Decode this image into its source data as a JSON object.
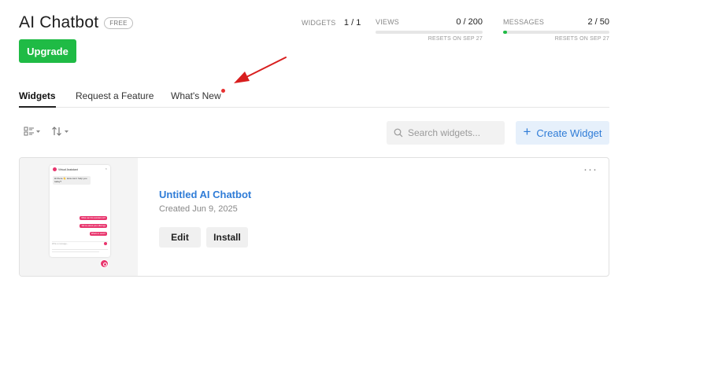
{
  "header": {
    "title": "AI Chatbot",
    "plan_badge": "FREE",
    "upgrade_label": "Upgrade"
  },
  "stats": {
    "widgets": {
      "label": "WIDGETS",
      "value": "1 / 1"
    },
    "views": {
      "label": "VIEWS",
      "value": "0 / 200",
      "reset": "RESETS ON SEP 27",
      "progress": 0.0
    },
    "messages": {
      "label": "MESSAGES",
      "value": "2 / 50",
      "reset": "RESETS ON SEP 27",
      "progress": 0.04
    }
  },
  "tabs": [
    {
      "label": "Widgets",
      "active": true
    },
    {
      "label": "Request a Feature",
      "active": false
    },
    {
      "label": "What's New",
      "active": false,
      "has_dot": true
    }
  ],
  "toolbar": {
    "search_placeholder": "Search widgets...",
    "create_label": "Create Widget"
  },
  "widgets": [
    {
      "name": "Untitled AI Chatbot",
      "created": "Created Jun 9, 2025",
      "edit_label": "Edit",
      "install_label": "Install",
      "preview": {
        "assistant_name": "Virtual Assistant",
        "greeting": "Hi there 👋 How can I help you today?",
        "suggestions": [
          "What can this assistant do?",
          "Tell me about your offerings",
          "What's in stock?"
        ],
        "input_placeholder": "Write a message..."
      }
    }
  ],
  "colors": {
    "brand_green": "#1fbb45",
    "link_blue": "#2f7cd7",
    "accent_pink": "#e8356d",
    "annotation_red": "#d81e1e"
  }
}
